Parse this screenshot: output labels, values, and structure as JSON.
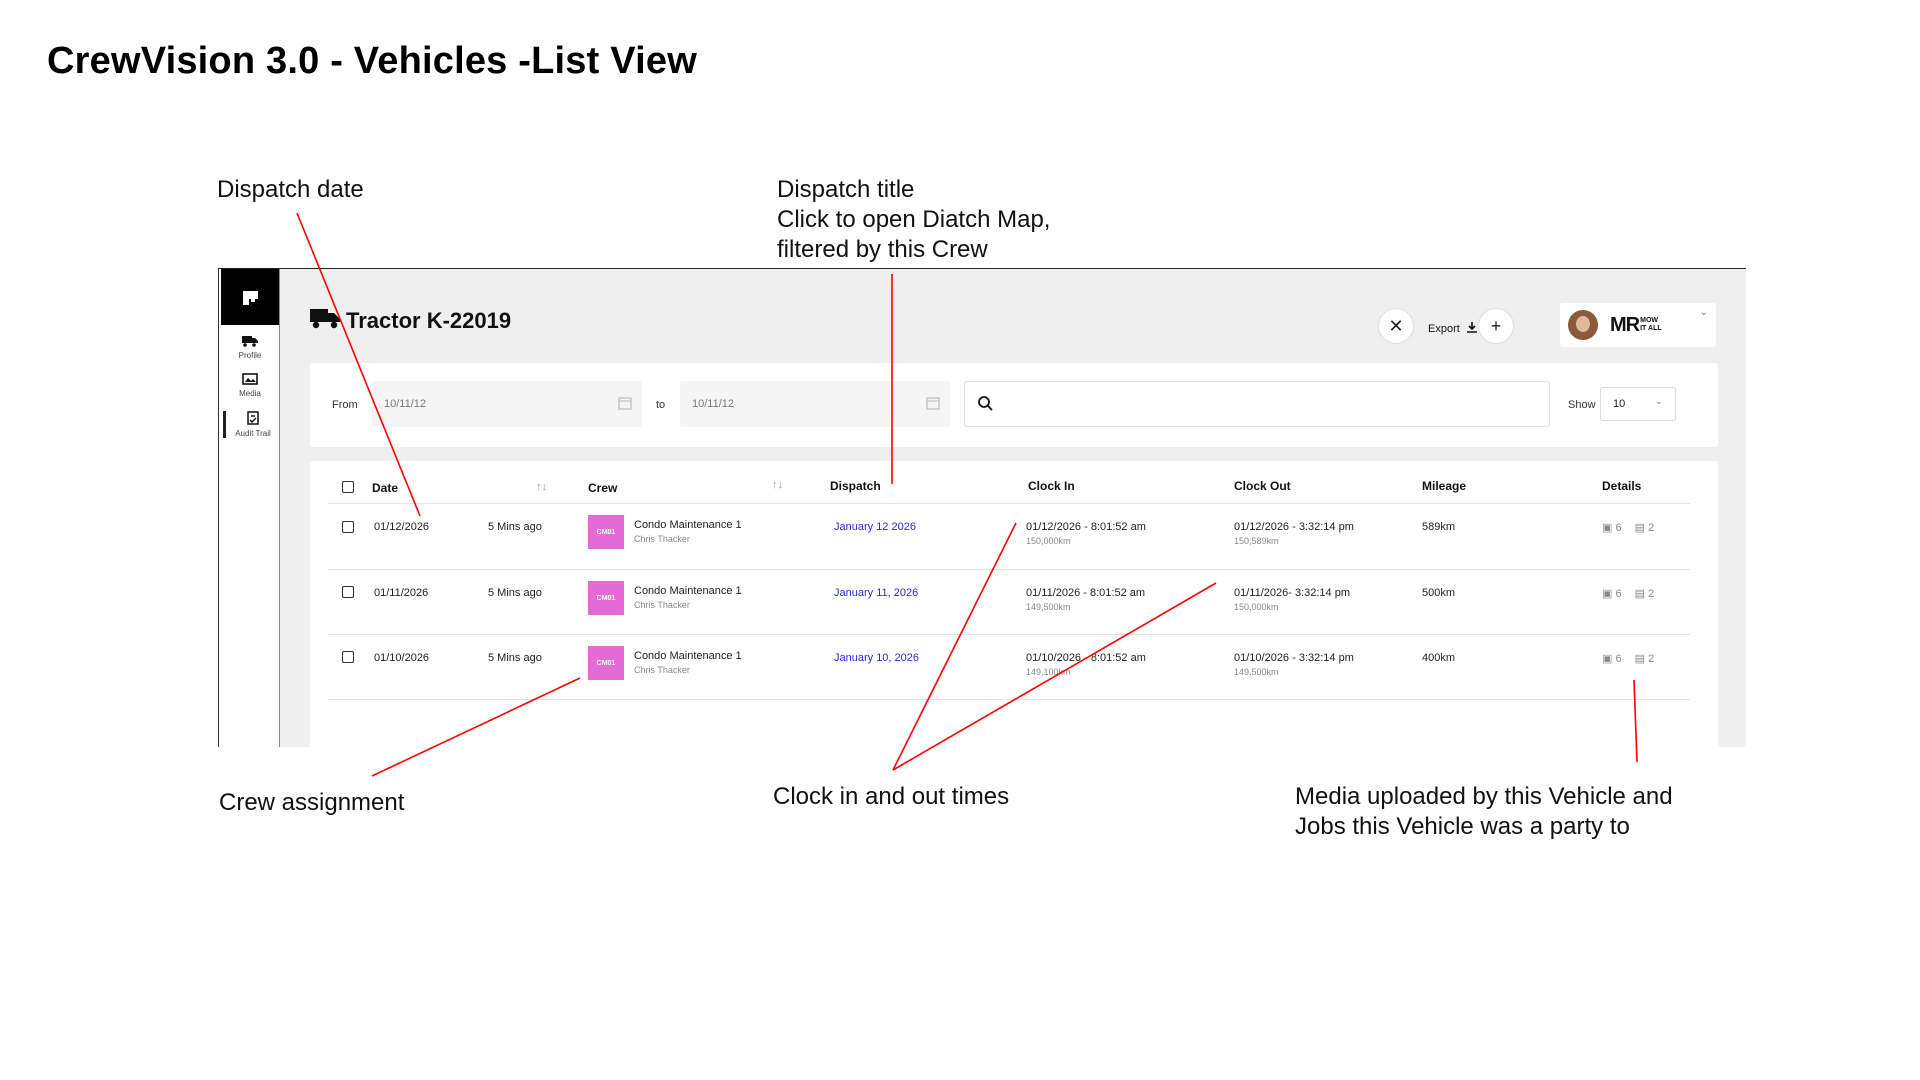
{
  "page_title": "CrewVision 3.0 - Vehicles -List View",
  "annotations": {
    "dispatch_date": "Dispatch date",
    "dispatch_title_line1": "Dispatch title",
    "dispatch_title_line2": "Click to open Diatch Map,",
    "dispatch_title_line3": "filtered by this Crew",
    "crew_assignment": "Crew assignment",
    "clock_times": "Clock in and out times",
    "media_line1": "Media uploaded by this Vehicle and",
    "media_line2": "Jobs this Vehicle was a party to"
  },
  "sidebar": {
    "items": [
      {
        "label": "Profile",
        "icon": "truck-icon"
      },
      {
        "label": "Media",
        "icon": "image-icon"
      },
      {
        "label": "Audit Trail",
        "icon": "clipboard-icon"
      }
    ]
  },
  "header": {
    "vehicle_title": "Tractor K-22019",
    "export_label": "Export",
    "logo_text_main": "MR",
    "logo_text_small_1": "MOW",
    "logo_text_small_2": "IT ALL"
  },
  "filters": {
    "from_label": "From",
    "from_value": "10/11/12",
    "to_label": "to",
    "to_value": "10/11/12",
    "search_placeholder": "",
    "show_label": "Show",
    "show_value": "10"
  },
  "table": {
    "columns": [
      "Date",
      "Crew",
      "Dispatch",
      "Clock In",
      "Clock Out",
      "Mileage",
      "Details"
    ],
    "rows": [
      {
        "date": "01/12/2026",
        "ago": "5 Mins ago",
        "badge": "CM01",
        "crew_name": "Condo Maintenance 1",
        "crew_lead": "Chris Thacker",
        "dispatch": "January 12 2026",
        "clock_in": "01/12/2026 - 8:01:52 am",
        "clock_in_km": "150,000km",
        "clock_out": "01/12/2026 - 3:32:14 pm",
        "clock_out_km": "150,589km",
        "mileage": "589km",
        "media_count": "6",
        "jobs_count": "2"
      },
      {
        "date": "01/11/2026",
        "ago": "5 Mins ago",
        "badge": "CM01",
        "crew_name": "Condo Maintenance 1",
        "crew_lead": "Chris Thacker",
        "dispatch": "January 11, 2026",
        "clock_in": "01/11/2026 - 8:01:52 am",
        "clock_in_km": "149,500km",
        "clock_out": "01/11/2026- 3:32:14 pm",
        "clock_out_km": "150,000km",
        "mileage": "500km",
        "media_count": "6",
        "jobs_count": "2"
      },
      {
        "date": "01/10/2026",
        "ago": "5 Mins ago",
        "badge": "CM01",
        "crew_name": "Condo Maintenance 1",
        "crew_lead": "Chris Thacker",
        "dispatch": "January 10, 2026",
        "clock_in": "01/10/2026 - 8:01:52 am",
        "clock_in_km": "149,100km",
        "clock_out": "01/10/2026 - 3:32:14 pm",
        "clock_out_km": "149,500km",
        "mileage": "400km",
        "media_count": "6",
        "jobs_count": "2"
      }
    ]
  },
  "colors": {
    "badge": "#e46ad8",
    "link": "#2b2bd6",
    "annotation_line": "#ff0000",
    "panel_bg": "#efefef"
  }
}
